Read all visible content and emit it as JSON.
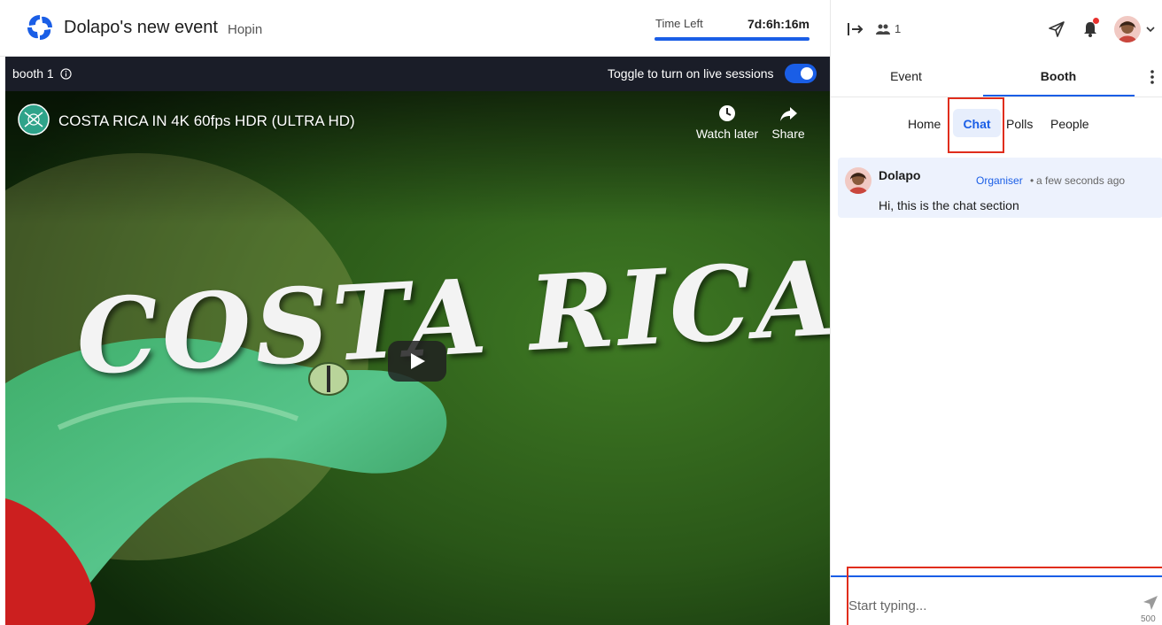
{
  "header": {
    "event_title": "Dolapo's new event",
    "organization": "Hopin",
    "time_left_label": "Time Left",
    "time_left_value": "7d:6h:16m"
  },
  "booth_bar": {
    "booth_name": "booth 1",
    "live_toggle_label": "Toggle to turn on live sessions",
    "live_toggle_on": true
  },
  "video": {
    "title": "COSTA RICA IN 4K 60fps HDR (ULTRA HD)",
    "watch_later_label": "Watch later",
    "share_label": "Share",
    "thumbnail_text": "COSTA RICA"
  },
  "sidebar": {
    "attendee_count": "1",
    "tabs": [
      {
        "label": "Event",
        "active": false
      },
      {
        "label": "Booth",
        "active": true
      }
    ],
    "sub_tabs": [
      {
        "label": "Home",
        "active": false
      },
      {
        "label": "Chat",
        "active": true
      },
      {
        "label": "Polls",
        "active": false
      },
      {
        "label": "People",
        "active": false
      }
    ]
  },
  "chat": {
    "messages": [
      {
        "author": "Dolapo",
        "role": "Organiser",
        "separator": "•",
        "time": "a few seconds ago",
        "text": "Hi, this is the chat section"
      }
    ],
    "composer": {
      "placeholder": "Start typing...",
      "char_limit": "500"
    }
  },
  "colors": {
    "accent": "#1a5ee6",
    "booth_bar": "#1a1d28",
    "message_bg": "#edf2fd",
    "annotation": "#e02d1c",
    "notification": "#e8312e"
  }
}
